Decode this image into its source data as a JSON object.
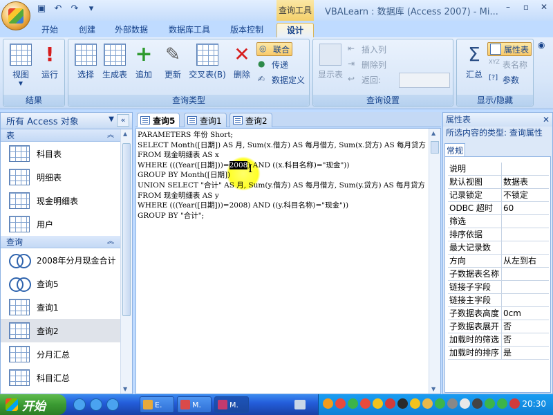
{
  "window": {
    "title": "VBALearn : 数据库 (Access 2007) - Mi...",
    "context_tab_group": "查询工具",
    "minimize": "–",
    "restore": "▫",
    "close": "✕"
  },
  "ribbon_tabs": [
    "开始",
    "创建",
    "外部数据",
    "数据库工具",
    "版本控制",
    "设计"
  ],
  "ribbon": {
    "groups": {
      "results": {
        "label": "结果",
        "view": "视图",
        "run": "运行"
      },
      "query_type": {
        "label": "查询类型",
        "select": "选择",
        "make_table": "生成表",
        "append": "追加",
        "update": "更新",
        "crosstab": "交叉表(B)",
        "delete": "删除",
        "union": "联合",
        "pass_through": "传递",
        "data_definition": "数据定义"
      },
      "query_setup": {
        "label": "查询设置",
        "show_table": "显示表",
        "insert_column": "插入列",
        "delete_column": "删除列",
        "return": "返回:"
      },
      "show_hide": {
        "label": "显示/隐藏",
        "totals": "汇总",
        "property_sheet": "属性表",
        "table_names": "表名称",
        "parameters": "参数"
      }
    }
  },
  "nav_pane": {
    "title": "所有 Access 对象",
    "sections": [
      {
        "name": "表",
        "items": [
          "科目表",
          "明细表",
          "现金明细表",
          "用户"
        ]
      },
      {
        "name": "查询",
        "items": [
          "2008年分月现金合计",
          "查询5",
          "查询1",
          "查询2",
          "分月汇总",
          "科目汇总"
        ]
      }
    ]
  },
  "doc_tabs": [
    "查询5",
    "查询1",
    "查询2"
  ],
  "sql": {
    "before_highlight": "PARAMETERS 年份 Short;\nSELECT Month([日期]) AS 月, Sum(x.借方) AS 每月借方, Sum(x.贷方) AS 每月贷方\nFROM 现金明细表 AS x\nWHERE (((Year([日期]))=",
    "highlight": "2008",
    "after_highlight": ") AND ((x.科目名称)=\"现金\"))\nGROUP BY Month([日期])\nUNION SELECT \"合计\" AS 月, Sum(y.借方) AS 每月借方, Sum(y.贷方) AS 每月贷方\nFROM 现金明细表 AS y\nWHERE (((Year([日期]))=2008) AND ((y.科目名称)=\"现金\"))\nGROUP BY \"合计\";"
  },
  "property_sheet": {
    "title": "属性表",
    "selection_type_label": "所选内容的类型: 查询属性",
    "tab": "常规",
    "rows": [
      {
        "name": "说明",
        "value": ""
      },
      {
        "name": "默认视图",
        "value": "数据表"
      },
      {
        "name": "记录锁定",
        "value": "不锁定"
      },
      {
        "name": "ODBC 超时",
        "value": "60"
      },
      {
        "name": "筛选",
        "value": ""
      },
      {
        "name": "排序依据",
        "value": ""
      },
      {
        "name": "最大记录数",
        "value": ""
      },
      {
        "name": "方向",
        "value": "从左到右"
      },
      {
        "name": "子数据表名称",
        "value": ""
      },
      {
        "name": "链接子字段",
        "value": ""
      },
      {
        "name": "链接主字段",
        "value": ""
      },
      {
        "name": "子数据表高度",
        "value": "0cm"
      },
      {
        "name": "子数据表展开",
        "value": "否"
      },
      {
        "name": "加载时的筛选",
        "value": "否"
      },
      {
        "name": "加载时的排序",
        "value": "是"
      }
    ]
  },
  "taskbar": {
    "start": "开始",
    "buttons": [
      "E.",
      "M.",
      "M."
    ],
    "clock": "20:30"
  },
  "colors": {
    "ribbon_bg": "#d7e6f9",
    "accent_text": "#15428b",
    "taskbar": "#245edb",
    "start_green": "#3a9a32",
    "highlight_yellow": "#ffff00"
  }
}
